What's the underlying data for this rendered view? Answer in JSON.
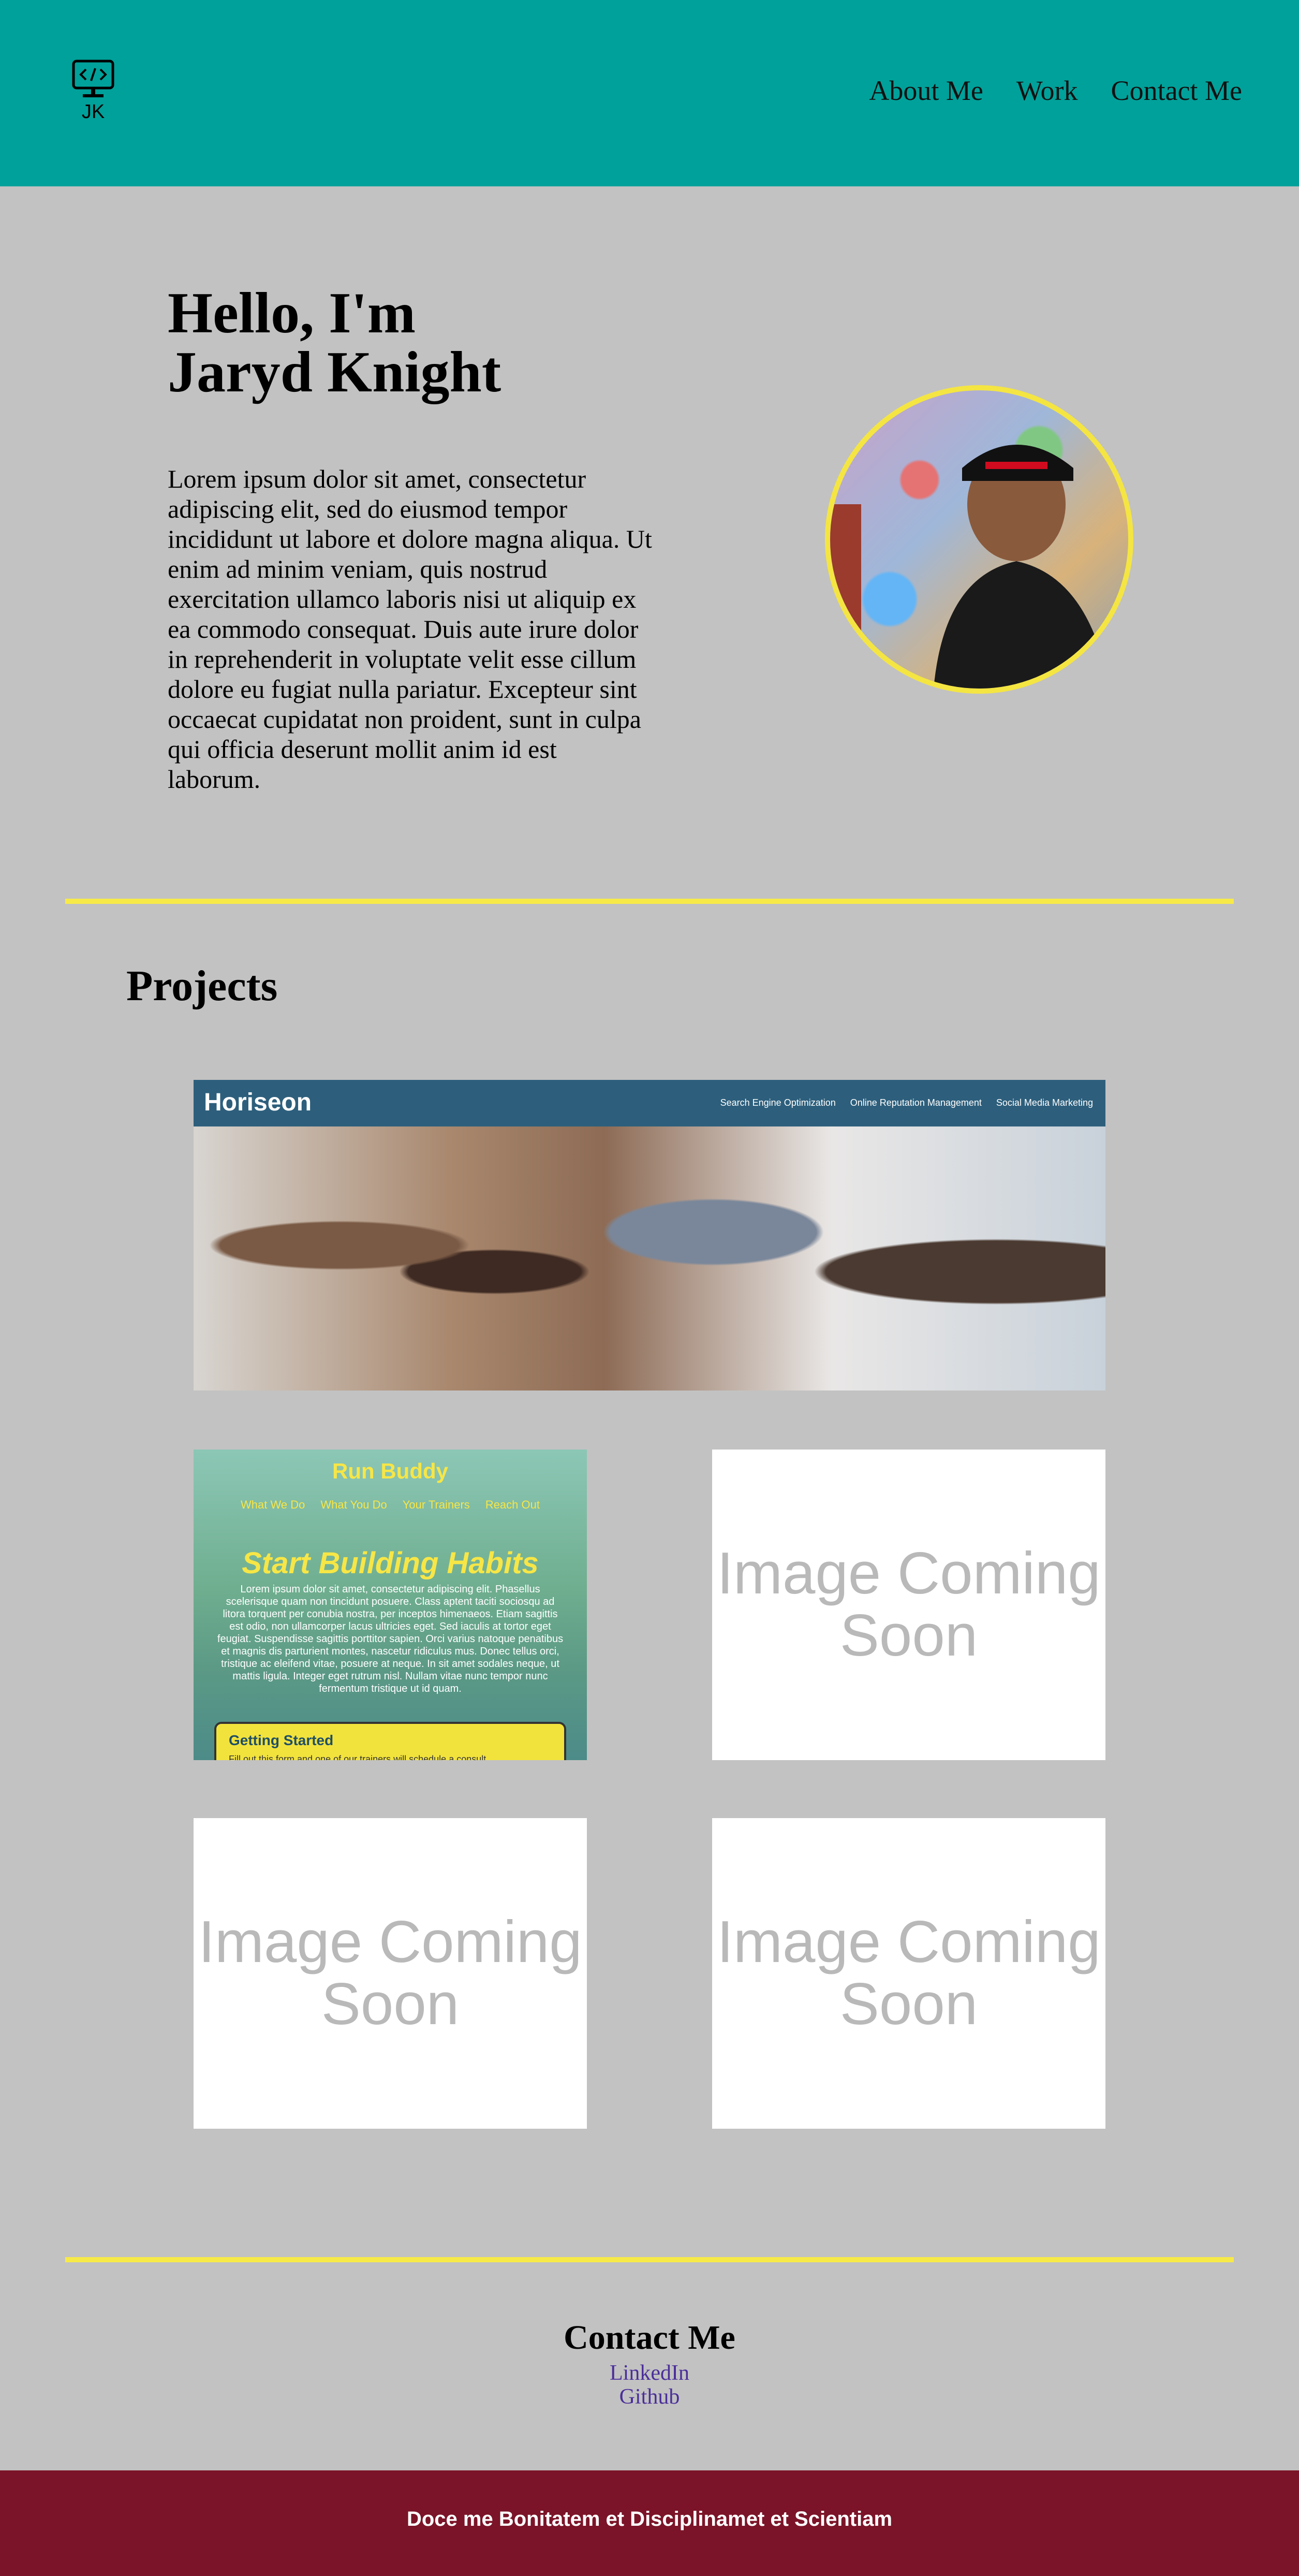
{
  "header": {
    "logo_text": "JK",
    "nav": [
      "About Me",
      "Work",
      "Contact Me"
    ]
  },
  "hero": {
    "title": "Hello, I'm Jaryd Knight",
    "text": "Lorem ipsum dolor sit amet, consectetur adipiscing elit, sed do eiusmod tempor incididunt ut labore et dolore magna aliqua. Ut enim ad minim veniam, quis nostrud exercitation ullamco laboris nisi ut aliquip ex ea commodo consequat. Duis aute irure dolor in reprehenderit in voluptate velit esse cillum dolore eu fugiat nulla pariatur. Excepteur sint occaecat cupidatat non proident, sunt in culpa qui officia deserunt mollit anim id est laborum."
  },
  "projects": {
    "title": "Projects",
    "horiseon": {
      "brand": "Horiseon",
      "links": [
        "Search Engine Optimization",
        "Online Reputation Management",
        "Social Media Marketing"
      ]
    },
    "run_buddy": {
      "title": "Run Buddy",
      "nav": [
        "What We Do",
        "What You Do",
        "Your Trainers",
        "Reach Out"
      ],
      "headline": "Start Building Habits",
      "body": "Lorem ipsum dolor sit amet, consectetur adipiscing elit. Phasellus scelerisque quam non tincidunt posuere. Class aptent taciti sociosqu ad litora torquent per conubia nostra, per inceptos himenaeos. Etiam sagittis est odio, non ullamcorper lacus ultricies eget. Sed iaculis at tortor eget feugiat. Suspendisse sagittis porttitor sapien. Orci varius natoque penatibus et magnis dis parturient montes, nascetur ridiculus mus. Donec tellus orci, tristique ac eleifend vitae, posuere at neque. In sit amet sodales neque, ut mattis ligula. Integer eget rutrum nisl. Nullam vitae nunc tempor nunc fermentum tristique ut id quam.",
      "box_title": "Getting Started",
      "box_text": "Fill out this form and one of our trainers will schedule a consult"
    },
    "placeholder_text": "Image Coming Soon"
  },
  "contact": {
    "title": "Contact Me",
    "links": [
      "LinkedIn",
      "Github"
    ]
  },
  "footer": {
    "text": "Doce me Bonitatem et Disciplinamet et Scientiam"
  },
  "colors": {
    "header_bg": "#00a19a",
    "page_bg": "#c2c2c2",
    "accent": "#f7ea48",
    "footer_bg": "#7b1428",
    "link": "#4b2f9a"
  }
}
